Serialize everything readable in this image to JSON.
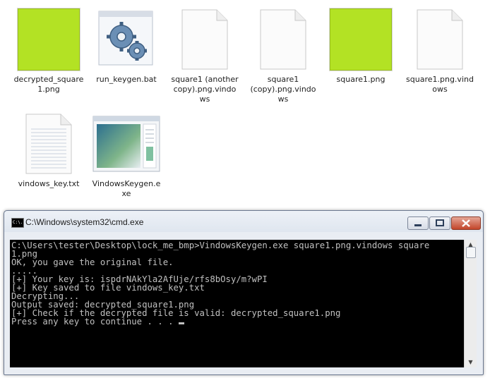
{
  "files": [
    {
      "name": "decrypted_square1.png",
      "label": "decrypted_square\n1.png",
      "kind": "green-image"
    },
    {
      "name": "run_keygen.bat",
      "label": "run_keygen.bat",
      "kind": "batch"
    },
    {
      "name": "square1 (another copy).png.vindows",
      "label": "square1 (another\ncopy).png.vindo\nws",
      "kind": "blank-doc"
    },
    {
      "name": "square1 (copy).png.vindows",
      "label": "square1\n(copy).png.vindo\nws",
      "kind": "blank-doc"
    },
    {
      "name": "square1.png",
      "label": "square1.png",
      "kind": "green-image"
    },
    {
      "name": "square1.png.vindows",
      "label": "square1.png.vind\nows",
      "kind": "blank-doc"
    },
    {
      "name": "vindows_key.txt",
      "label": "vindows_key.txt",
      "kind": "text-doc"
    },
    {
      "name": "VindowsKeygen.exe",
      "label": "VindowsKeygen.e\nxe",
      "kind": "exe"
    }
  ],
  "cmd": {
    "title": "C:\\Windows\\system32\\cmd.exe",
    "icon_text": "C:\\.",
    "lines": [
      "C:\\Users\\tester\\Desktop\\lock_me_bmp>VindowsKeygen.exe square1.png.vindows square",
      "1.png",
      "OK, you gave the original file.",
      ".....",
      "[+] Your key is: ispdrNAkYla2AfUje/rfs8bOsy/m?wPI",
      "[+] Key saved to file vindows_key.txt",
      "Decrypting...",
      "Output saved: decrypted_square1.png",
      "[+] Check if the decrypted file is valid: decrypted_square1.png",
      "Press any key to continue . . . "
    ]
  },
  "colors": {
    "green_thumb": "#b3e224",
    "console_bg": "#000000",
    "console_fg": "#c0c0c0"
  }
}
